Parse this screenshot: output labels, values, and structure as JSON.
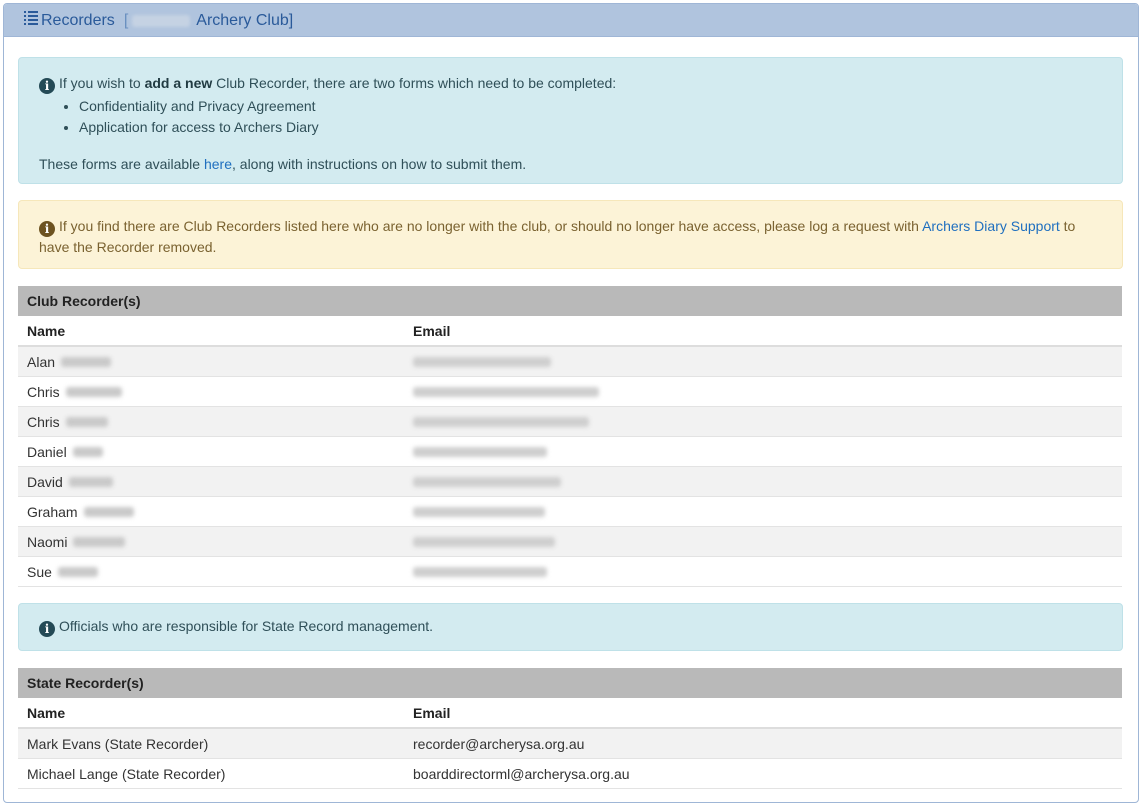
{
  "header": {
    "title": "Recorders",
    "club_suffix": "Archery Club]",
    "bracket_open": "[",
    "icon": "list-icon"
  },
  "add_recorder_alert": {
    "intro_prefix": "If you wish to ",
    "intro_bold": "add a new",
    "intro_suffix": " Club Recorder, there are two forms which need to be completed:",
    "items": [
      "Confidentiality and Privacy Agreement",
      "Application for access to Archers Diary"
    ],
    "forms_prefix": "These forms are available ",
    "forms_link": "here",
    "forms_suffix": ", along with instructions on how to submit them."
  },
  "remove_recorder_alert": {
    "text_before": "If you find there are Club Recorders listed here who are no longer with the club, or should no longer have access, please log a request with ",
    "link": "Archers Diary Support",
    "text_after": " to have the Recorder removed."
  },
  "club_recorders": {
    "title": "Club Recorder(s)",
    "col_name": "Name",
    "col_email": "Email",
    "rows": [
      {
        "first_name": "Alan"
      },
      {
        "first_name": "Chris"
      },
      {
        "first_name": "Chris"
      },
      {
        "first_name": "Daniel"
      },
      {
        "first_name": "David"
      },
      {
        "first_name": "Graham"
      },
      {
        "first_name": "Naomi"
      },
      {
        "first_name": "Sue"
      }
    ]
  },
  "state_info_alert": {
    "text": "Officials who are responsible for State Record management."
  },
  "state_recorders": {
    "title": "State Recorder(s)",
    "col_name": "Name",
    "col_email": "Email",
    "rows": [
      {
        "name": "Mark Evans (State Recorder)",
        "email": "recorder@archerysa.org.au"
      },
      {
        "name": "Michael Lange (State Recorder)",
        "email": "boarddirectorml@archerysa.org.au"
      }
    ]
  },
  "colors": {
    "header_bg": "#b0c4de",
    "info_bg": "#d3ebf0",
    "warning_bg": "#fcf3d7",
    "table_title_bg": "#b9b9b9",
    "link": "#1f6fbf"
  }
}
